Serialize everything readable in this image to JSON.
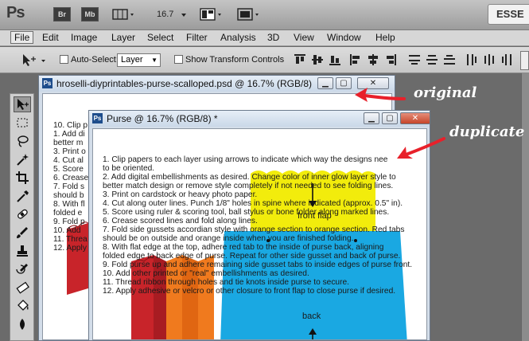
{
  "app": {
    "logo": "Ps",
    "bridge_label": "Br",
    "minibridge_label": "Mb",
    "zoom": "16.7",
    "workspace_label": "ESSE"
  },
  "menu": [
    "File",
    "Edit",
    "Image",
    "Layer",
    "Select",
    "Filter",
    "Analysis",
    "3D",
    "View",
    "Window",
    "Help"
  ],
  "options": {
    "auto_select_label": "Auto-Select:",
    "auto_select_value": "Layer",
    "transform_label": "Show Transform Controls"
  },
  "original_doc": {
    "title": "hroselli-diyprintables-purse-scalloped.psd @ 16.7% (RGB/8)",
    "lines": [
      "10. Clip p",
      "1. Add di",
      "better m",
      "3. Print o",
      "4. Cut al",
      "5. Score",
      "6. Crease",
      "7. Fold s",
      "should b",
      "8. With fl",
      "folded e",
      "9. Fold p",
      "10. Add",
      "11. Threa",
      "12. Apply"
    ]
  },
  "duplicate_doc": {
    "title": "Purse @ 16.7% (RGB/8) *",
    "instructions": [
      "1. Clip papers to each layer using arrows to indicate which way the designs nee",
      "to be oriented.",
      "2. Add digital embellishments as desired. Change color of inner glow layer style to",
      "better match design or remove style completely if not needed to see folding lines.",
      "3. Print on cardstock or heavy photo paper.",
      "4. Cut along outer lines. Punch 1/8\" holes in spine where indicated (approx. 0.5\" in).",
      "5. Score using ruler & scoring tool, ball stylus or bone folder along marked lines.",
      "6. Crease scored lines and fold along lines.",
      "7. Fold side gussets accordian style with orange section to orange section. Red tabs",
      "should be on outside and orange inside when you are finished folding.",
      "8. With flat edge at the top, adhere red tab to the inside of purse back, aligning",
      "folded edge to back edge of purse. Repeat for other side gusset and back of purse.",
      "9. Fold purse up and adhere remaining side gusset tabs to inside edges of purse front.",
      "10. Add other printed or \"real\" embellishments as desired.",
      "11. Thread ribbon through holes and tie knots inside purse to secure.",
      "12. Apply adhesive or velcro or other closure to front flap to close purse if desired."
    ],
    "flap_label": "front flap",
    "back_label": "back"
  },
  "annotations": {
    "original": "original",
    "duplicate": "duplicate"
  },
  "colors": {
    "yellow": "#f2ec0c",
    "blue": "#1aa8e2",
    "orange": "#f07a1e",
    "red": "#c8242a",
    "arrow_red": "#e8202a"
  }
}
